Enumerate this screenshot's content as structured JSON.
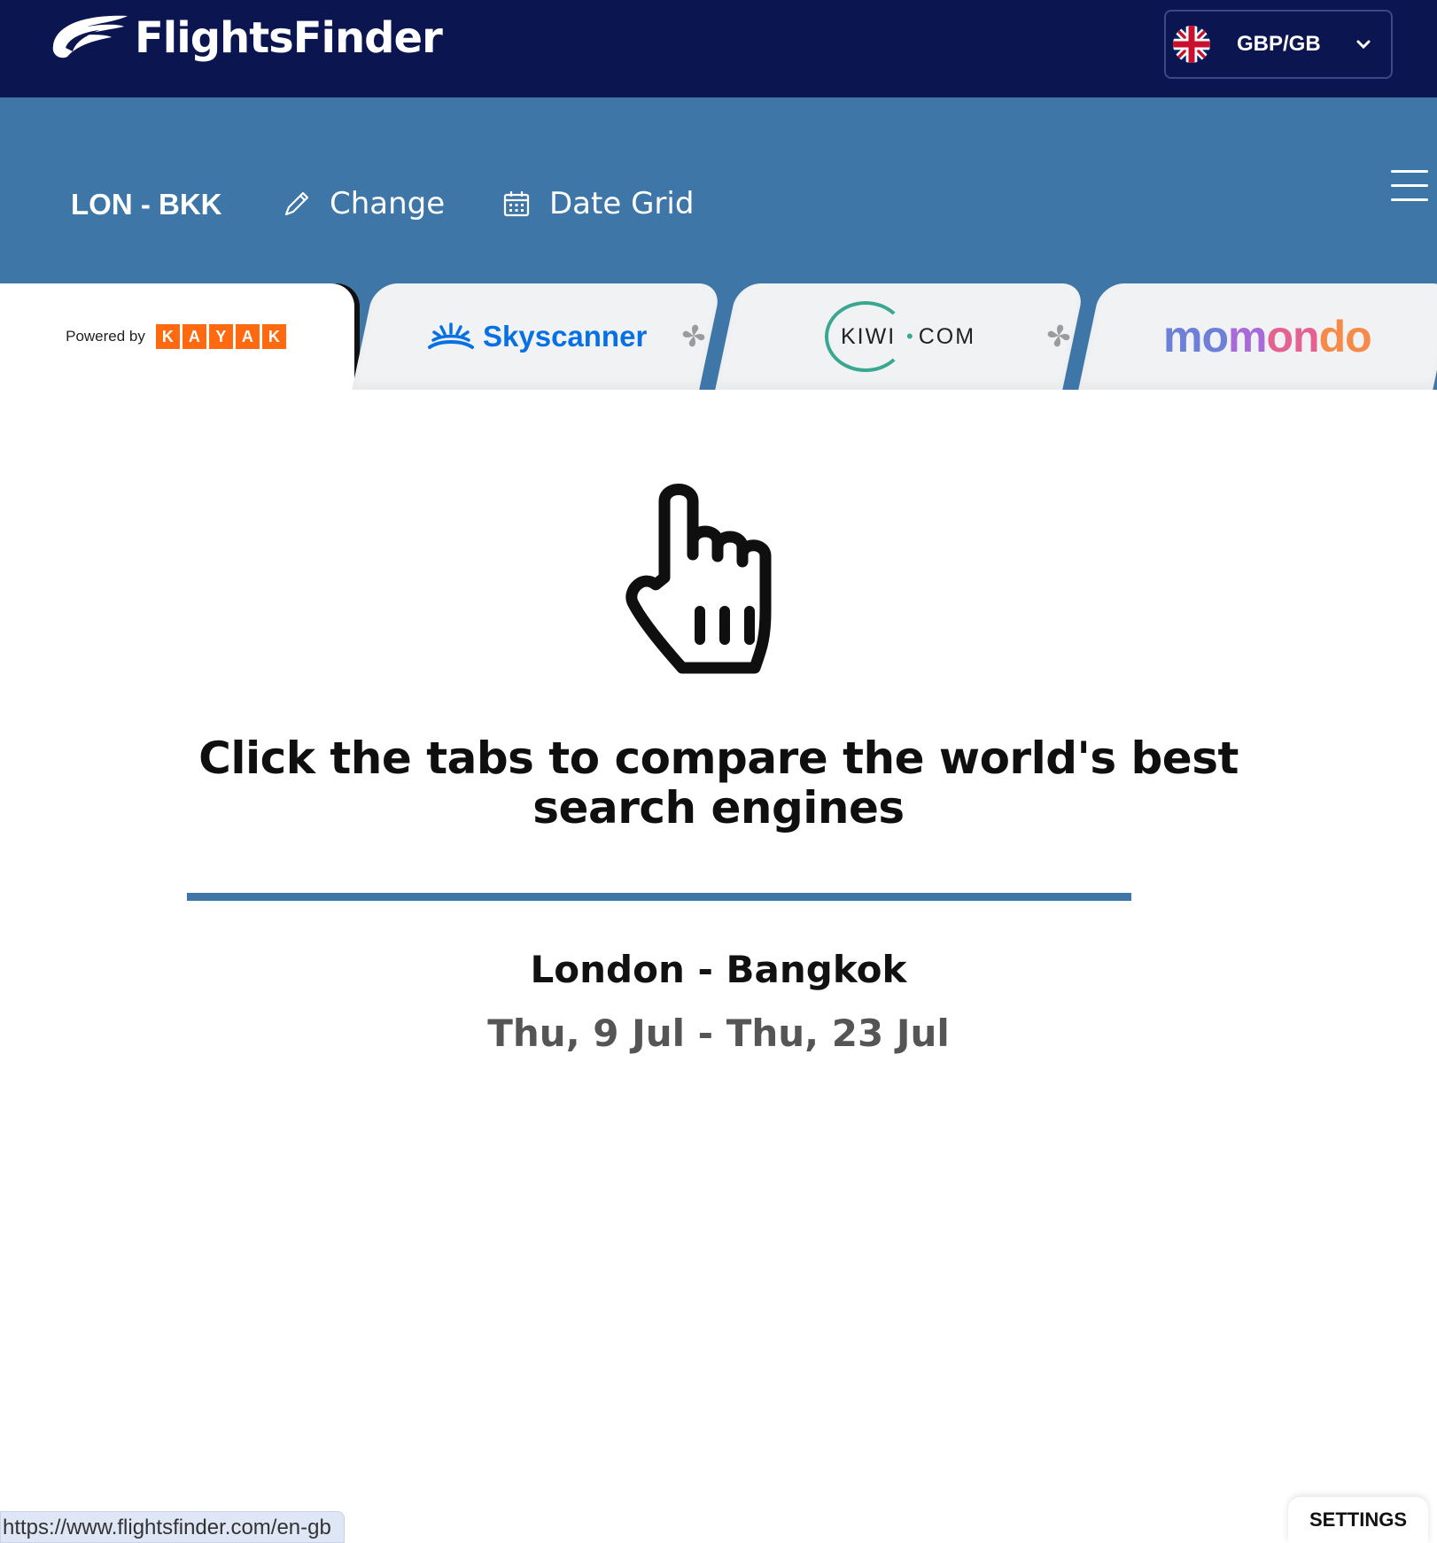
{
  "header": {
    "brand": "FlightsFinder",
    "currency": "GBP/GB",
    "flag_icon": "uk-flag-icon"
  },
  "subheader": {
    "route_code": "LON - BKK",
    "change_label": "Change",
    "date_grid_label": "Date Grid"
  },
  "tabs": {
    "kayak": {
      "powered_by": "Powered by",
      "letters": [
        "K",
        "A",
        "Y",
        "A",
        "K"
      ]
    },
    "skyscanner": {
      "label": "Skyscanner"
    },
    "kiwi": {
      "left": "KIWI",
      "right": "COM"
    },
    "momondo": {
      "label": "momondo"
    }
  },
  "main": {
    "headline": "Click the tabs to compare the world's best search engines",
    "route": "London - Bangkok",
    "dates": "Thu, 9 Jul - Thu, 23 Jul"
  },
  "footer": {
    "status_url": "https://www.flightsfinder.com/en-gb",
    "settings_label": "SETTINGS"
  },
  "colors": {
    "header_bg": "#0b1650",
    "subheader_bg": "#3e76a7",
    "kayak_orange": "#ff690f",
    "skyscanner_blue": "#0770e3",
    "kiwi_green": "#3aa891"
  }
}
